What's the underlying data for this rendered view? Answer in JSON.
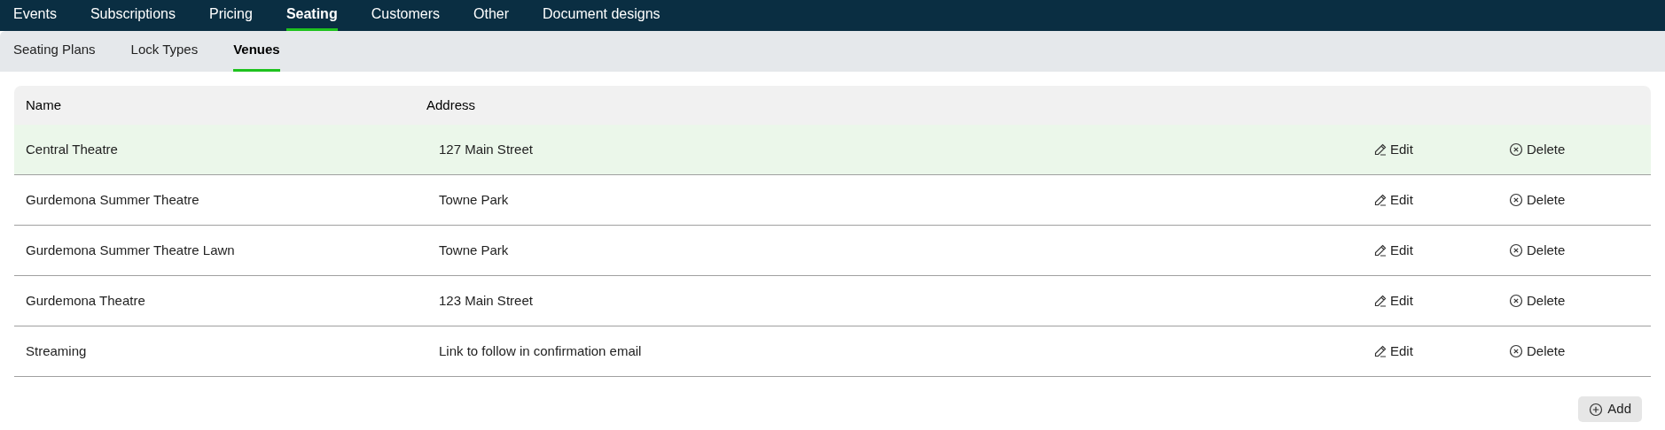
{
  "main_nav": [
    {
      "label": "Events",
      "selected": false
    },
    {
      "label": "Subscriptions",
      "selected": false
    },
    {
      "label": "Pricing",
      "selected": false
    },
    {
      "label": "Seating",
      "selected": true
    },
    {
      "label": "Customers",
      "selected": false
    },
    {
      "label": "Other",
      "selected": false
    },
    {
      "label": "Document designs",
      "selected": false
    }
  ],
  "sub_nav": [
    {
      "label": "Seating Plans",
      "selected": false
    },
    {
      "label": "Lock Types",
      "selected": false
    },
    {
      "label": "Venues",
      "selected": true
    }
  ],
  "table": {
    "columns": [
      "Name",
      "Address"
    ],
    "rows": [
      {
        "name": "Central Theatre",
        "address": "127 Main Street",
        "edit": "Edit",
        "delete": "Delete",
        "selected": true
      },
      {
        "name": "Gurdemona Summer Theatre",
        "address": "Towne Park",
        "edit": "Edit",
        "delete": "Delete",
        "selected": false
      },
      {
        "name": "Gurdemona Summer Theatre Lawn",
        "address": "Towne Park",
        "edit": "Edit",
        "delete": "Delete",
        "selected": false
      },
      {
        "name": "Gurdemona Theatre",
        "address": "123 Main Street",
        "edit": "Edit",
        "delete": "Delete",
        "selected": false
      },
      {
        "name": "Streaming",
        "address": "Link to follow in confirmation email",
        "edit": "Edit",
        "delete": "Delete",
        "selected": false
      }
    ]
  },
  "add_button": "Add"
}
